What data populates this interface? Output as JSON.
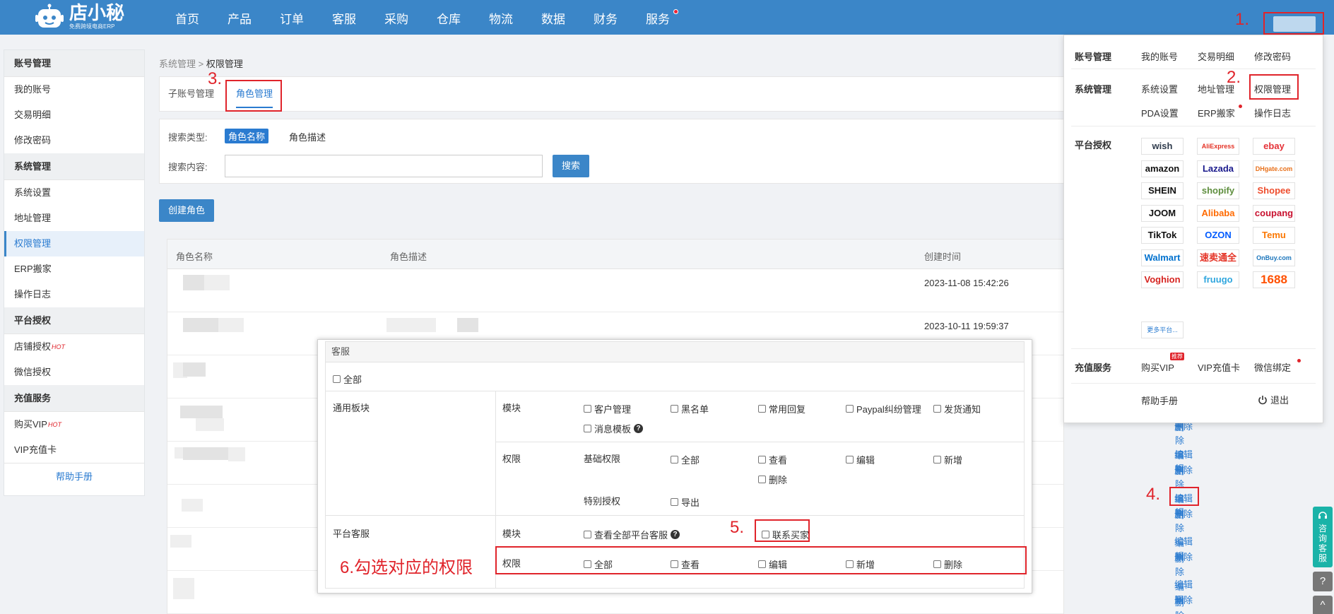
{
  "app": {
    "logo_text": "店小秘",
    "logo_sub": "免费跨境电商ERP"
  },
  "nav": [
    "首页",
    "产品",
    "订单",
    "客服",
    "采购",
    "仓库",
    "物流",
    "数据",
    "财务",
    "服务"
  ],
  "sidebar": {
    "sections": [
      {
        "title": "账号管理",
        "items": [
          "我的账号",
          "交易明细",
          "修改密码"
        ]
      },
      {
        "title": "系统管理",
        "items": [
          "系统设置",
          "地址管理",
          "权限管理",
          "ERP搬家",
          "操作日志"
        ]
      },
      {
        "title": "平台授权",
        "items": [
          "店铺授权",
          "微信授权"
        ]
      },
      {
        "title": "充值服务",
        "items": [
          "购买VIP",
          "VIP充值卡"
        ]
      }
    ],
    "hot": "HOT",
    "help": "帮助手册"
  },
  "breadcrumb": {
    "parent": "系统管理",
    "sep": ">",
    "current": "权限管理"
  },
  "tabs": [
    "子账号管理",
    "角色管理"
  ],
  "search": {
    "type_label": "搜索类型:",
    "type_selected": "角色名称",
    "type_other": "角色描述",
    "content_label": "搜索内容:",
    "button": "搜索"
  },
  "create_button": "创建角色",
  "table": {
    "headers": [
      "角色名称",
      "角色描述",
      "创建时间"
    ],
    "rows": [
      {
        "time": "2023-11-08 15:42:26"
      },
      {
        "time": "2023-10-11 19:59:37"
      }
    ],
    "edit": "编辑",
    "delete": "删除"
  },
  "annotations": [
    "1.",
    "2.",
    "3.",
    "4.",
    "5.",
    "6.勾选对应的权限"
  ],
  "dropdown": {
    "account": {
      "head": "账号管理",
      "links": [
        "我的账号",
        "交易明细",
        "修改密码"
      ]
    },
    "system": {
      "head": "系统管理",
      "links": [
        "系统设置",
        "地址管理",
        "权限管理",
        "PDA设置",
        "ERP搬家",
        "操作日志"
      ]
    },
    "platform": {
      "head": "平台授权",
      "logos": [
        "wish",
        "AliExpress",
        "ebay",
        "amazon",
        "Lazada",
        "DHgate.com",
        "SHEIN",
        "shopify",
        "Shopee",
        "JOOM",
        "Alibaba",
        "coupang",
        "TikTok",
        "OZON",
        "Temu",
        "Walmart",
        "速卖通全托管",
        "OnBuy.com",
        "Voghion",
        "fruugo",
        "1688"
      ],
      "more": "更多平台..."
    },
    "recharge": {
      "head": "充值服务",
      "links": [
        "购买VIP",
        "VIP充值卡",
        "微信绑定"
      ],
      "badge": "推荐"
    },
    "help": "帮助手册",
    "logout": "退出"
  },
  "modal": {
    "title": "客服",
    "all": "全部",
    "group1": {
      "name": "通用板块",
      "module_label": "模块",
      "modules": [
        "客户管理",
        "黑名单",
        "常用回复",
        "Paypal纠纷管理",
        "发货通知",
        "消息模板"
      ],
      "perm_label": "权限",
      "basic_label": "基础权限",
      "basic": [
        "全部",
        "查看",
        "编辑",
        "新增",
        "删除"
      ],
      "special_label": "特别授权",
      "special": [
        "导出"
      ]
    },
    "group2": {
      "name": "平台客服",
      "module_label": "模块",
      "modules": [
        "查看全部平台客服",
        "联系买家"
      ],
      "perm_label": "权限",
      "perms": [
        "全部",
        "查看",
        "编辑",
        "新增",
        "删除"
      ]
    }
  },
  "float": {
    "cs": "咨询客服",
    "help": "?",
    "top": "^"
  }
}
